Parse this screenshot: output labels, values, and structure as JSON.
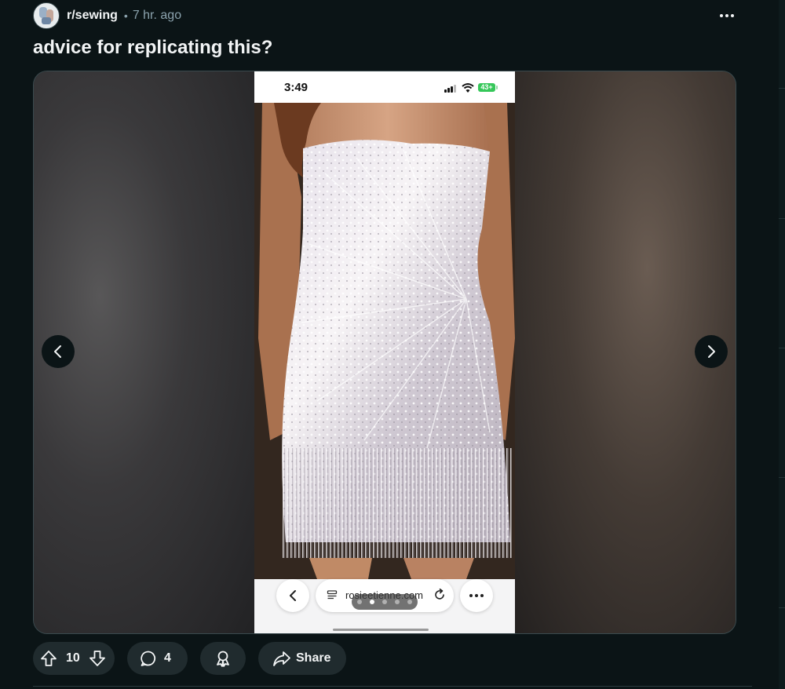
{
  "post": {
    "subreddit": "r/sewing",
    "separator": "•",
    "age": "7 hr. ago",
    "title": "advice for replicating this?"
  },
  "phone_screenshot": {
    "status_time": "3:49",
    "battery_level": "43+",
    "url": "rosieetienne.com",
    "carousel_dots": 5,
    "carousel_active_dot": 2
  },
  "actions": {
    "score": "10",
    "comment_count": "4",
    "share_label": "Share"
  },
  "icons": {
    "more": "more-horizontal-icon",
    "prev": "chevron-left-icon",
    "next": "chevron-right-icon",
    "upvote": "upvote-icon",
    "downvote": "downvote-icon",
    "comment": "comment-icon",
    "award": "award-icon",
    "share": "share-icon"
  },
  "colors": {
    "background": "#0b1416",
    "pill": "#202b2e",
    "text": "#f2f4f5",
    "muted": "#8ba2ad",
    "battery": "#35c759"
  }
}
